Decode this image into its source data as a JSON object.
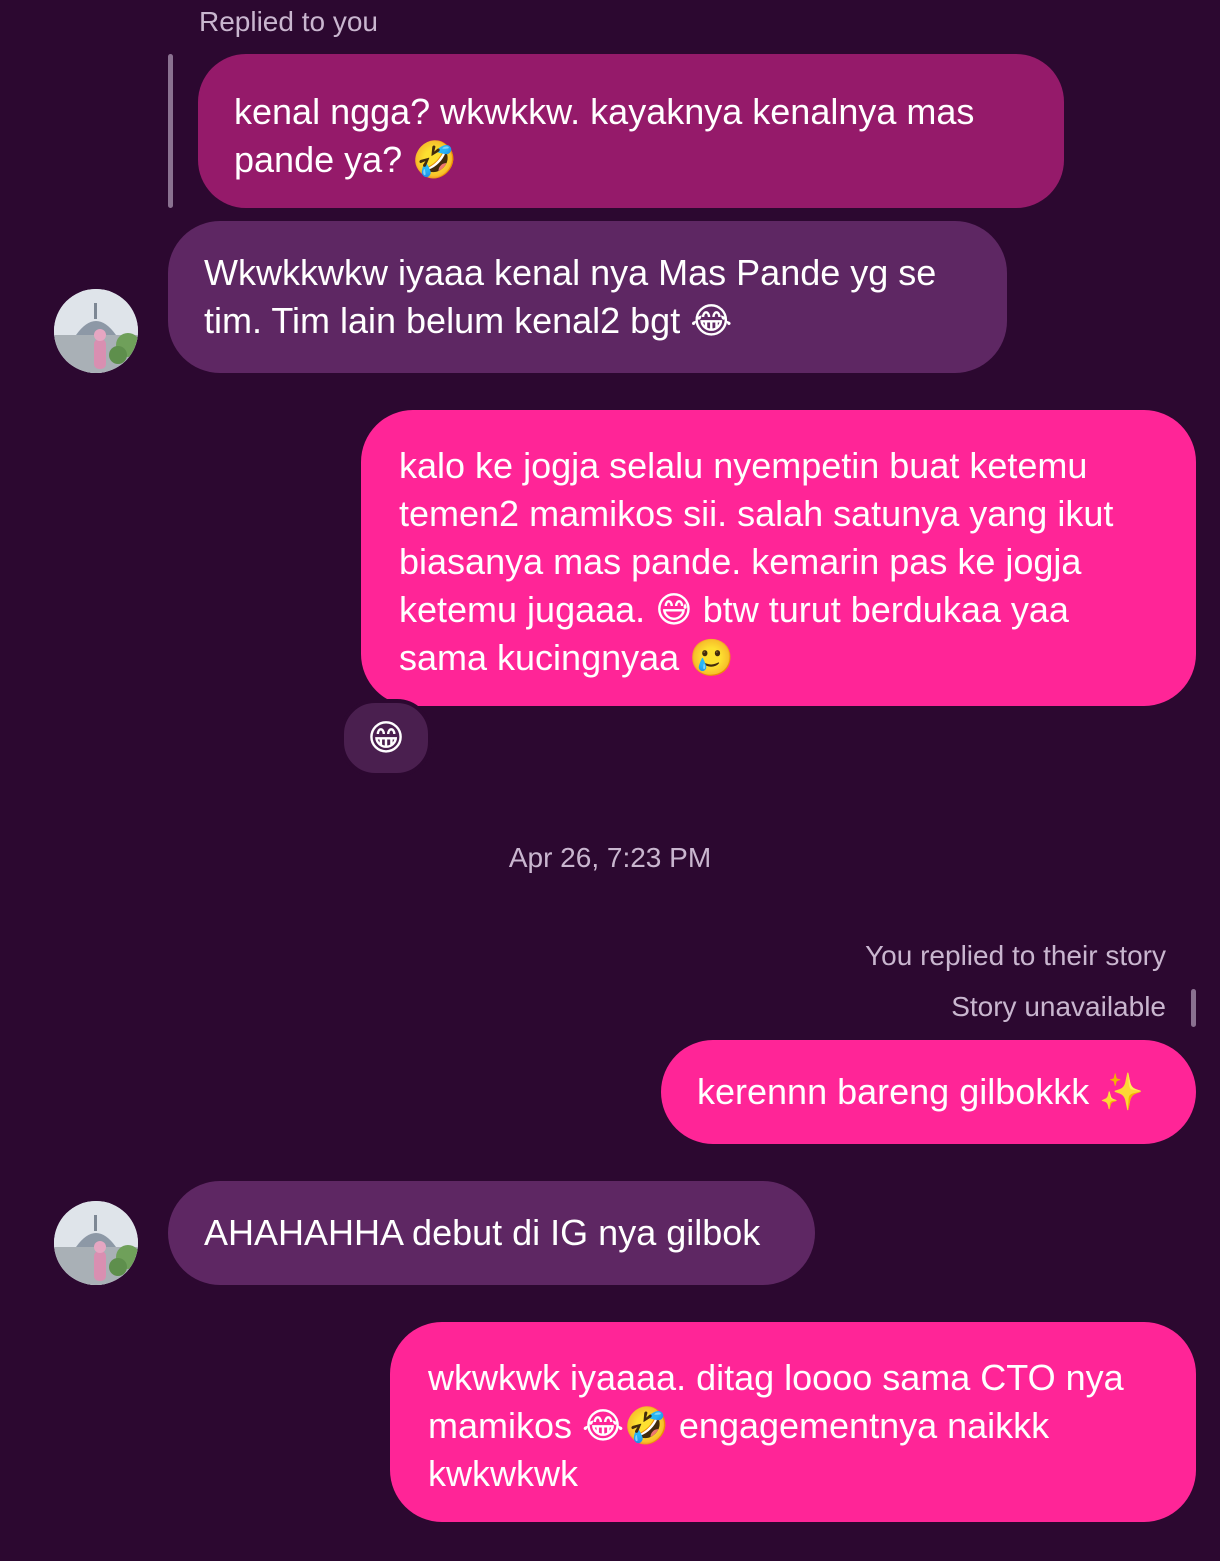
{
  "thread": {
    "replied_to_you_label": "Replied to you",
    "quoted_message": "kenal ngga? wkwkkw. kayaknya kenalnya mas pande ya? 🤣",
    "msg_in_1": "Wkwkkwkw iyaaa kenal nya Mas Pande yg se tim. Tim lain belum kenal2 bgt 😂",
    "msg_out_1": "kalo ke jogja selalu nyempetin buat ketemu temen2 mamikos sii. salah satunya yang ikut biasanya mas pande. kemarin pas ke jogja ketemu jugaaa. 😅 btw turut berdukaa yaa sama kucingnyaa 🥲",
    "reaction_1": "😁",
    "timestamp": "Apr 26, 7:23 PM",
    "story_reply_label": "You replied to their story",
    "story_unavailable_label": "Story unavailable",
    "msg_out_2": "kerennn bareng gilbokkk ✨",
    "msg_in_2": "AHAHAHHA debut di IG nya gilbok",
    "msg_out_3": "wkwkwk iyaaaa. ditag loooo sama CTO nya mamikos 😂🤣 engagementnya naikkk kwkwkwk"
  },
  "colors": {
    "background": "#2c0830",
    "incoming_bubble": "#5e2763",
    "outgoing_bubble": "#ff2597",
    "quoted_bubble": "#951a6a"
  }
}
